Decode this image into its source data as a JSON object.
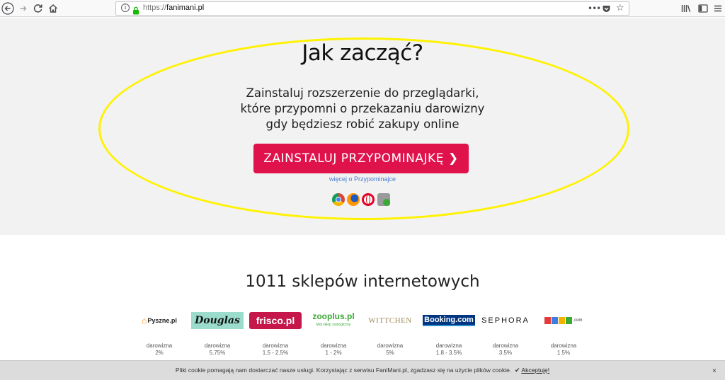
{
  "browser": {
    "url_scheme": "https://",
    "url_host": "fanimani.pl",
    "more_glyph": "•••"
  },
  "hero": {
    "title": "Jak zacząć?",
    "desc_line1": "Zainstaluj rozszerzenie do przeglądarki,",
    "desc_line2": "które przypomni o przekazaniu darowizny",
    "desc_line3": "gdy będziesz robić zakupy online",
    "cta_label": "ZAINSTALUJ  PRZYPOMINAJKĘ",
    "cta_chevron": "❯",
    "more_link": "więcej o Przypominajce",
    "browsers": [
      "chrome-icon",
      "firefox-icon",
      "opera-icon",
      "safari-icon"
    ],
    "highlight_color": "#fff200",
    "cta_color": "#e0124b"
  },
  "stores": {
    "title": "1011 sklepów internetowych",
    "items": [
      {
        "name": "Pyszne.pl",
        "label": "darowizna",
        "value": "2%"
      },
      {
        "name": "Douglas",
        "label": "darowizna",
        "value": "5.75%"
      },
      {
        "name": "frisco.pl",
        "label": "darowizna",
        "value": "1.5 - 2.5%"
      },
      {
        "name": "zooplus.pl",
        "sub": "Mój sklep zoologiczny",
        "label": "darowizna",
        "value": "1 - 2%"
      },
      {
        "name": "WITTCHEN",
        "label": "darowizna",
        "value": "5%"
      },
      {
        "name": "Booking.com",
        "label": "darowizna",
        "value": "1.8 - 3.5%"
      },
      {
        "name": "SEPHORA",
        "label": "darowizna",
        "value": "3.5%"
      },
      {
        "name": "ZOOGO.com",
        "label": "darowizna",
        "value": "1.5%"
      }
    ]
  },
  "cookie": {
    "text": "Pliki cookie pomagają nam dostarczać nasze usługi. Korzystając z serwisu FaniMani.pl, zgadzasz się na użycie plików cookie.",
    "accept": "Akceptuję!",
    "close": "×"
  }
}
